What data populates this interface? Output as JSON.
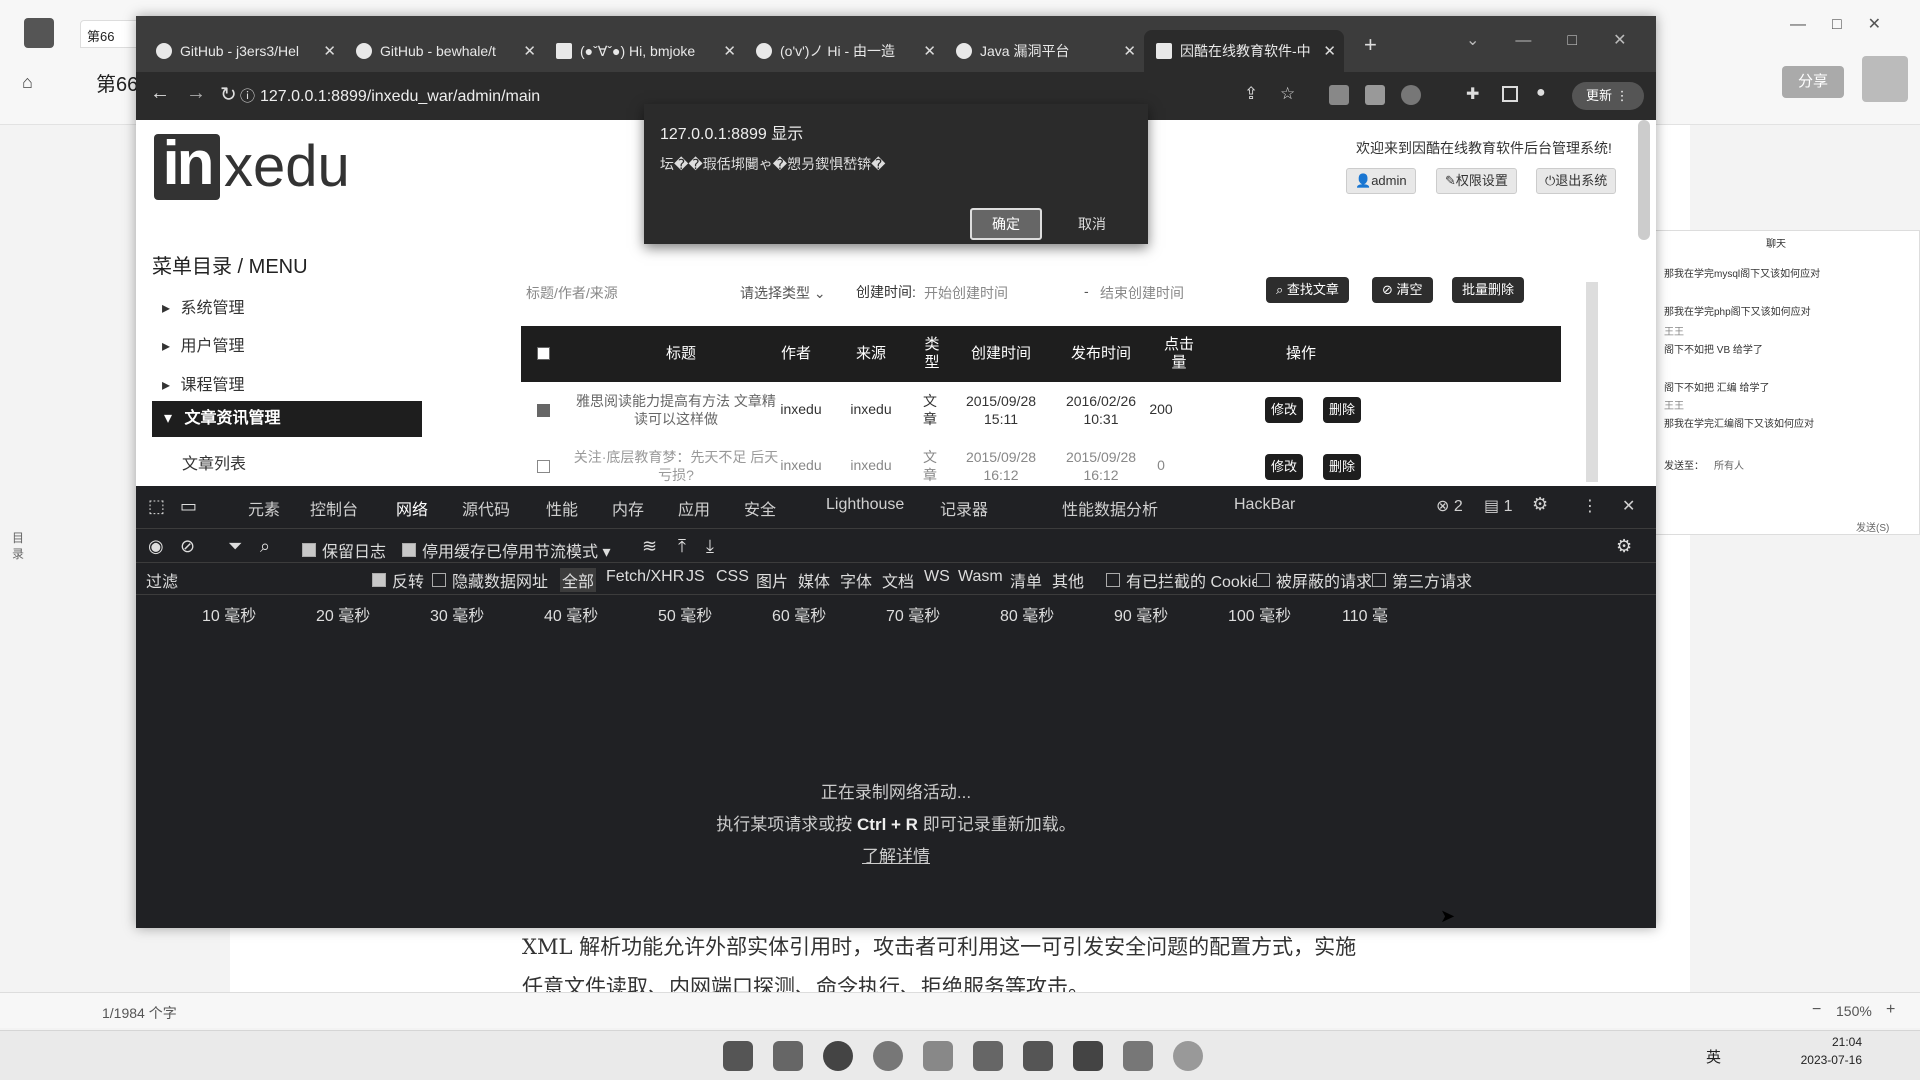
{
  "background_app": {
    "tab_title": "第66",
    "heading": "第66",
    "share_button": "分享",
    "doc_line1": "XML 解析功能允许外部实体引用时，攻击者可利用这一可引发安全问题的配置方式，实施",
    "doc_line2": "任意文件读取、内网端口探测、命令执行、拒绝服务等攻击。",
    "word_count": "1/1984 个字",
    "zoom": "150%",
    "outline_label": "目录",
    "chat_title": "聊天",
    "chat_messages": [
      "那我在学完mysql阁下又该如何应对",
      "那我在学完php阁下又该如何应对",
      "阁下不如把 VB 给学了",
      "阁下不如把 汇编 给学了",
      "那我在学完汇编阁下又该如何应对"
    ],
    "chat_names": [
      "王王",
      "王王"
    ],
    "chat_send_to_label": "发送至：",
    "chat_send_to_value": "所有人",
    "chat_send_button": "发送(S)"
  },
  "browser": {
    "tabs": [
      {
        "title": "GitHub - j3ers3/Hel"
      },
      {
        "title": "GitHub - bewhale/t"
      },
      {
        "title": "(●ˇ∀ˇ●) Hi, bmjoke"
      },
      {
        "title": "(o'v')ノ Hi - 由一造"
      },
      {
        "title": "Java 漏洞平台"
      },
      {
        "title": "因酷在线教育软件-中"
      }
    ],
    "url": "127.0.0.1:8899/inxedu_war/admin/main",
    "update_button": "更新"
  },
  "page": {
    "logo_in": "in",
    "logo_rest": "xedu",
    "welcome": "欢迎来到因酷在线教育软件后台管理系统!",
    "admin_button": "admin",
    "perm_button": "权限设置",
    "logout_button": "退出系统",
    "menu_title": "菜单目录 / MENU",
    "menu_items": [
      "系统管理",
      "用户管理",
      "课程管理"
    ],
    "menu_active": "文章资讯管理",
    "menu_sub": "文章列表",
    "search": {
      "placeholder": "标题/作者/来源",
      "type_select": "请选择类型",
      "created_label": "创建时间:",
      "start_placeholder": "开始创建时间",
      "dash": "-",
      "end_placeholder": "结束创建时间",
      "find_button": "查找文章",
      "clear_button": "清空",
      "batch_delete_button": "批量删除"
    },
    "table": {
      "headers": [
        "标题",
        "作者",
        "来源",
        "类型",
        "创建时间",
        "发布时间",
        "点击量",
        "操作"
      ],
      "rows": [
        {
          "checked": true,
          "title": "雅思阅读能力提高有方法 文章精读可以这样做",
          "author": "inxedu",
          "source": "inxedu",
          "type": "文章",
          "created": "2015/09/28 15:11",
          "published": "2016/02/26 10:31",
          "clicks": "200"
        },
        {
          "checked": false,
          "title": "关注·底层教育梦：先天不足 后天亏损?",
          "author": "inxedu",
          "source": "inxedu",
          "type": "文章",
          "created": "2015/09/28 16:12",
          "published": "2015/09/28 16:12",
          "clicks": "0"
        }
      ],
      "edit_label": "修改",
      "delete_label": "删除"
    }
  },
  "alert": {
    "origin": "127.0.0.1:8899 显示",
    "message": "坛��瑕佸垹闄ゃ�愬叧鍥惧嵆锛�",
    "ok_label": "确定",
    "cancel_label": "取消"
  },
  "devtools": {
    "tabs": [
      "元素",
      "控制台",
      "网络",
      "源代码",
      "性能",
      "内存",
      "应用",
      "安全",
      "Lighthouse",
      "记录器",
      "性能数据分析",
      "HackBar"
    ],
    "issue_count": "2",
    "message_count": "1",
    "toolbar": {
      "preserve_log": "保留日志",
      "disable_cache": "停用缓存",
      "throttle": "已停用节流模式"
    },
    "filter": {
      "label": "过滤",
      "invert": "反转",
      "hide_data_urls": "隐藏数据网址",
      "types": [
        "全部",
        "Fetch/XHR",
        "JS",
        "CSS",
        "图片",
        "媒体",
        "字体",
        "文档",
        "WS",
        "Wasm",
        "清单",
        "其他"
      ],
      "blocked_cookies": "有已拦截的 Cookie",
      "blocked_requests": "被屏蔽的请求",
      "third_party": "第三方请求"
    },
    "timeline": [
      "10 毫秒",
      "20 毫秒",
      "30 毫秒",
      "40 毫秒",
      "50 毫秒",
      "60 毫秒",
      "70 毫秒",
      "80 毫秒",
      "90 毫秒",
      "100 毫秒",
      "110 毫"
    ],
    "recording": "正在录制网络活动...",
    "hint_prefix": "执行某项请求或按",
    "hint_keys": "Ctrl + R",
    "hint_suffix": "即可记录重新加载。",
    "learn_more": "了解详情"
  },
  "taskbar": {
    "ime": "英",
    "time": "21:04",
    "date": "2023-07-16"
  }
}
